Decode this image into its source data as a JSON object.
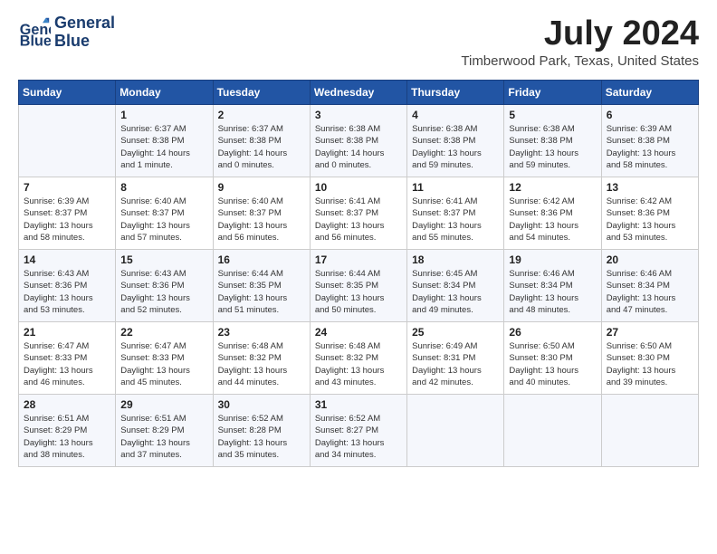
{
  "logo": {
    "line1": "General",
    "line2": "Blue"
  },
  "title": "July 2024",
  "location": "Timberwood Park, Texas, United States",
  "days_of_week": [
    "Sunday",
    "Monday",
    "Tuesday",
    "Wednesday",
    "Thursday",
    "Friday",
    "Saturday"
  ],
  "weeks": [
    [
      {
        "day": "",
        "detail": ""
      },
      {
        "day": "1",
        "detail": "Sunrise: 6:37 AM\nSunset: 8:38 PM\nDaylight: 14 hours\nand 1 minute."
      },
      {
        "day": "2",
        "detail": "Sunrise: 6:37 AM\nSunset: 8:38 PM\nDaylight: 14 hours\nand 0 minutes."
      },
      {
        "day": "3",
        "detail": "Sunrise: 6:38 AM\nSunset: 8:38 PM\nDaylight: 14 hours\nand 0 minutes."
      },
      {
        "day": "4",
        "detail": "Sunrise: 6:38 AM\nSunset: 8:38 PM\nDaylight: 13 hours\nand 59 minutes."
      },
      {
        "day": "5",
        "detail": "Sunrise: 6:38 AM\nSunset: 8:38 PM\nDaylight: 13 hours\nand 59 minutes."
      },
      {
        "day": "6",
        "detail": "Sunrise: 6:39 AM\nSunset: 8:38 PM\nDaylight: 13 hours\nand 58 minutes."
      }
    ],
    [
      {
        "day": "7",
        "detail": "Sunrise: 6:39 AM\nSunset: 8:37 PM\nDaylight: 13 hours\nand 58 minutes."
      },
      {
        "day": "8",
        "detail": "Sunrise: 6:40 AM\nSunset: 8:37 PM\nDaylight: 13 hours\nand 57 minutes."
      },
      {
        "day": "9",
        "detail": "Sunrise: 6:40 AM\nSunset: 8:37 PM\nDaylight: 13 hours\nand 56 minutes."
      },
      {
        "day": "10",
        "detail": "Sunrise: 6:41 AM\nSunset: 8:37 PM\nDaylight: 13 hours\nand 56 minutes."
      },
      {
        "day": "11",
        "detail": "Sunrise: 6:41 AM\nSunset: 8:37 PM\nDaylight: 13 hours\nand 55 minutes."
      },
      {
        "day": "12",
        "detail": "Sunrise: 6:42 AM\nSunset: 8:36 PM\nDaylight: 13 hours\nand 54 minutes."
      },
      {
        "day": "13",
        "detail": "Sunrise: 6:42 AM\nSunset: 8:36 PM\nDaylight: 13 hours\nand 53 minutes."
      }
    ],
    [
      {
        "day": "14",
        "detail": "Sunrise: 6:43 AM\nSunset: 8:36 PM\nDaylight: 13 hours\nand 53 minutes."
      },
      {
        "day": "15",
        "detail": "Sunrise: 6:43 AM\nSunset: 8:36 PM\nDaylight: 13 hours\nand 52 minutes."
      },
      {
        "day": "16",
        "detail": "Sunrise: 6:44 AM\nSunset: 8:35 PM\nDaylight: 13 hours\nand 51 minutes."
      },
      {
        "day": "17",
        "detail": "Sunrise: 6:44 AM\nSunset: 8:35 PM\nDaylight: 13 hours\nand 50 minutes."
      },
      {
        "day": "18",
        "detail": "Sunrise: 6:45 AM\nSunset: 8:34 PM\nDaylight: 13 hours\nand 49 minutes."
      },
      {
        "day": "19",
        "detail": "Sunrise: 6:46 AM\nSunset: 8:34 PM\nDaylight: 13 hours\nand 48 minutes."
      },
      {
        "day": "20",
        "detail": "Sunrise: 6:46 AM\nSunset: 8:34 PM\nDaylight: 13 hours\nand 47 minutes."
      }
    ],
    [
      {
        "day": "21",
        "detail": "Sunrise: 6:47 AM\nSunset: 8:33 PM\nDaylight: 13 hours\nand 46 minutes."
      },
      {
        "day": "22",
        "detail": "Sunrise: 6:47 AM\nSunset: 8:33 PM\nDaylight: 13 hours\nand 45 minutes."
      },
      {
        "day": "23",
        "detail": "Sunrise: 6:48 AM\nSunset: 8:32 PM\nDaylight: 13 hours\nand 44 minutes."
      },
      {
        "day": "24",
        "detail": "Sunrise: 6:48 AM\nSunset: 8:32 PM\nDaylight: 13 hours\nand 43 minutes."
      },
      {
        "day": "25",
        "detail": "Sunrise: 6:49 AM\nSunset: 8:31 PM\nDaylight: 13 hours\nand 42 minutes."
      },
      {
        "day": "26",
        "detail": "Sunrise: 6:50 AM\nSunset: 8:30 PM\nDaylight: 13 hours\nand 40 minutes."
      },
      {
        "day": "27",
        "detail": "Sunrise: 6:50 AM\nSunset: 8:30 PM\nDaylight: 13 hours\nand 39 minutes."
      }
    ],
    [
      {
        "day": "28",
        "detail": "Sunrise: 6:51 AM\nSunset: 8:29 PM\nDaylight: 13 hours\nand 38 minutes."
      },
      {
        "day": "29",
        "detail": "Sunrise: 6:51 AM\nSunset: 8:29 PM\nDaylight: 13 hours\nand 37 minutes."
      },
      {
        "day": "30",
        "detail": "Sunrise: 6:52 AM\nSunset: 8:28 PM\nDaylight: 13 hours\nand 35 minutes."
      },
      {
        "day": "31",
        "detail": "Sunrise: 6:52 AM\nSunset: 8:27 PM\nDaylight: 13 hours\nand 34 minutes."
      },
      {
        "day": "",
        "detail": ""
      },
      {
        "day": "",
        "detail": ""
      },
      {
        "day": "",
        "detail": ""
      }
    ]
  ]
}
